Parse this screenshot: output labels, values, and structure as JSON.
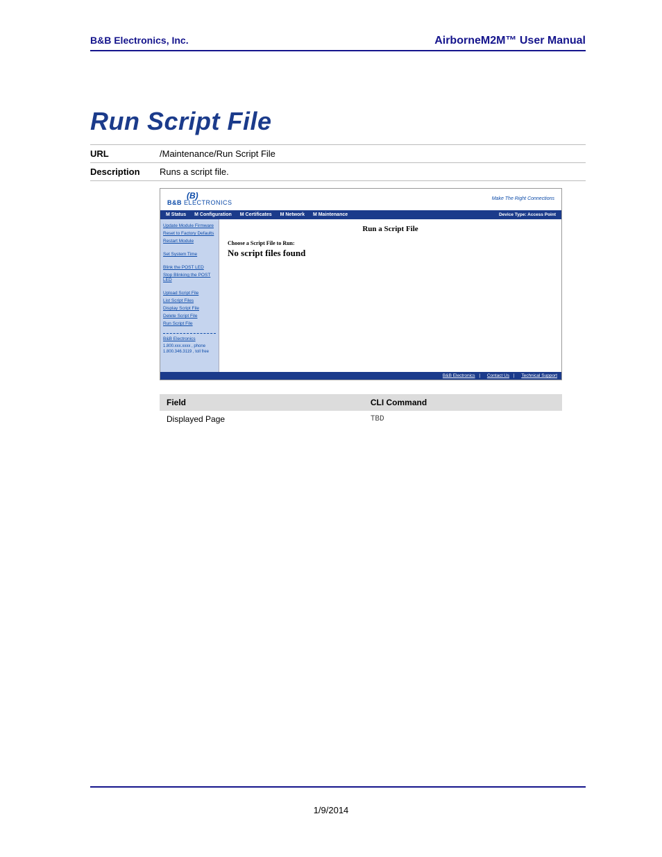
{
  "header": {
    "left": "B&B Electronics, Inc.",
    "right": "AirborneM2M™ User Manual"
  },
  "title": "Run Script File",
  "kv": [
    {
      "label": "URL",
      "value": "/Maintenance/Run Script File"
    },
    {
      "label": "Description",
      "value": "Runs a script file."
    }
  ],
  "shot": {
    "logo": {
      "b": "(B)",
      "text_bold": "B&B ",
      "text_thin": "ELECTRONICS"
    },
    "tagline": "Make The Right Connections",
    "nav": [
      "M Status",
      "M Configuration",
      "M Certificates",
      "M Network",
      "M Maintenance"
    ],
    "device_type": "Device Type: Access Point",
    "sidebar": {
      "group1": [
        "Update Module Firmware",
        "Reset to Factory Defaults",
        "Restart Module"
      ],
      "group2": [
        "Set System Time"
      ],
      "group3": [
        "Blink the POST LED",
        "Stop Blinking the POST LED"
      ],
      "group4": [
        "Upload Script File",
        "List Script Files",
        "Display Script File",
        "Delete Script File",
        "Run Script File"
      ],
      "contact_name": "B&B Electronics",
      "contact_phone_label": "phone",
      "contact_phone": "1.800.xxx.xxxx",
      "contact_toll_label": "toll free",
      "contact_toll": "1.800.346.3119"
    },
    "main_title": "Run a Script File",
    "choose_label": "Choose a Script File to Run:",
    "no_files": "No script files found",
    "footer_links": [
      "B&B Electronics",
      "Contact Us",
      "Technical Support"
    ]
  },
  "ftable": {
    "head": [
      "Field",
      "CLI Command"
    ],
    "rows": [
      {
        "field": "Displayed Page",
        "cli": "TBD"
      }
    ]
  },
  "footer_date": "1/9/2014"
}
